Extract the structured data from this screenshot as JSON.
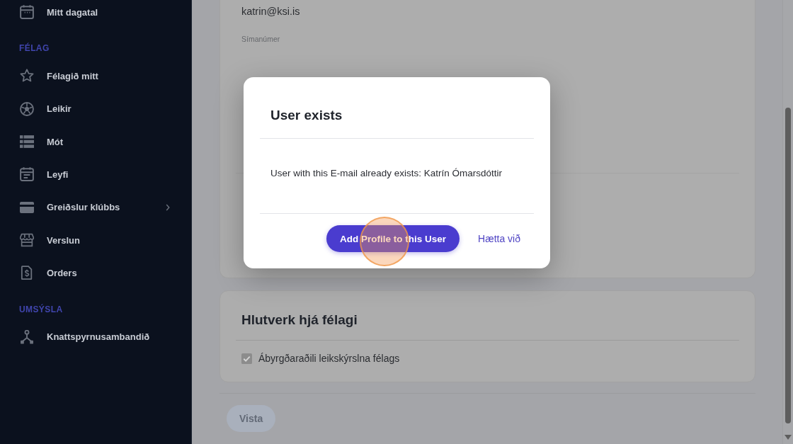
{
  "sidebar": {
    "groups": [
      {
        "items": [
          {
            "label": "Mitt dagatal",
            "selected": false,
            "has_submenu": false
          }
        ]
      },
      {
        "heading": "FÉLAG",
        "items": [
          {
            "label": "Félagið mitt",
            "selected": false,
            "has_submenu": false
          },
          {
            "label": "Leikir",
            "selected": false,
            "has_submenu": false
          },
          {
            "label": "Mót",
            "selected": false,
            "has_submenu": false
          },
          {
            "label": "Leyfi",
            "selected": false,
            "has_submenu": false
          },
          {
            "label": "Greiðslur klúbbs",
            "selected": false,
            "has_submenu": true
          },
          {
            "label": "Verslun",
            "selected": false,
            "has_submenu": false
          },
          {
            "label": "Orders",
            "selected": false,
            "has_submenu": false
          }
        ]
      },
      {
        "heading": "UMSÝSLA",
        "items": [
          {
            "label": "Knattspyrnusambandið",
            "selected": false,
            "has_submenu": false
          }
        ]
      }
    ]
  },
  "profile_card": {
    "email": {
      "value": "katrin@ksi.is"
    },
    "phone": {
      "label": "Símanúmer"
    }
  },
  "roles_card": {
    "title": "Hlutverk hjá félagi",
    "options": [
      {
        "label": "Ábyrgðaraðili leikskýrslna félags",
        "checked": true
      }
    ]
  },
  "save_button": {
    "label": "Vista",
    "disabled": true
  },
  "dialog": {
    "title": "User exists",
    "message": "User with this E-mail already exists: Katrín Ómarsdóttir",
    "buttons": [
      {
        "label": "Add Profile to this User",
        "kind": "primary"
      },
      {
        "label": "Hætta við",
        "kind": "link"
      }
    ]
  }
}
